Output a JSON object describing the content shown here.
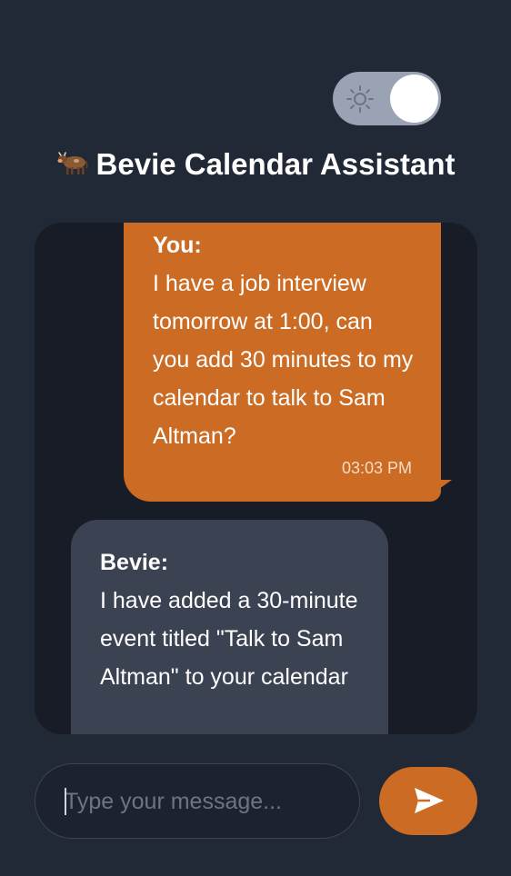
{
  "header": {
    "title": "Bevie Calendar Assistant",
    "title_icon": "cow-emoji-icon",
    "theme_toggle": {
      "icon": "sun-icon",
      "state": "dark-mode"
    }
  },
  "messages": [
    {
      "role": "user",
      "sender": "You:",
      "text": "I have a job interview tomorrow at 1:00, can you add 30 minutes to my calendar to talk to Sam Altman?",
      "time": "03:03 PM"
    },
    {
      "role": "assistant",
      "sender": "Bevie:",
      "text": "I have added a 30-minute event titled \"Talk to Sam Altman\" to your calendar"
    }
  ],
  "composer": {
    "placeholder": "Type your message...",
    "value": "",
    "send_icon": "send-icon"
  },
  "colors": {
    "background": "#222936",
    "chat_background": "#171c27",
    "user_bubble": "#cc6c24",
    "assistant_bubble": "#3b4252",
    "toggle_track": "#9aa3b4",
    "send_button": "#cc6c24"
  }
}
